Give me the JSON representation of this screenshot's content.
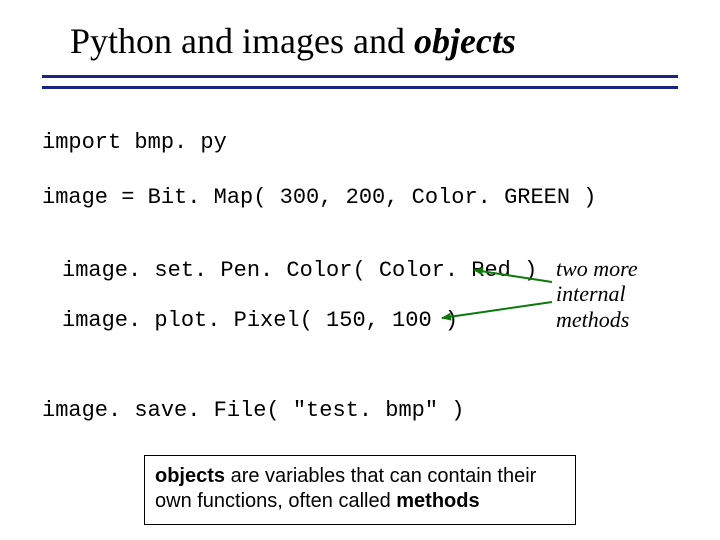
{
  "title": {
    "part1": "Python and images and ",
    "emphasis": "objects"
  },
  "code": {
    "import": "import bmp. py",
    "bitmap": "image = Bit. Map( 300, 200, Color. GREEN )",
    "setpen": "image. set. Pen. Color( Color. Red )",
    "plot": "image. plot. Pixel( 150, 100 )",
    "save": "image. save. File( \"test. bmp\" )"
  },
  "annotation": {
    "line1": "two more",
    "line2": "internal",
    "line3": "methods"
  },
  "footer": {
    "bold1": "objects",
    "mid": " are variables that can contain their own functions, often called ",
    "bold2": "methods"
  }
}
